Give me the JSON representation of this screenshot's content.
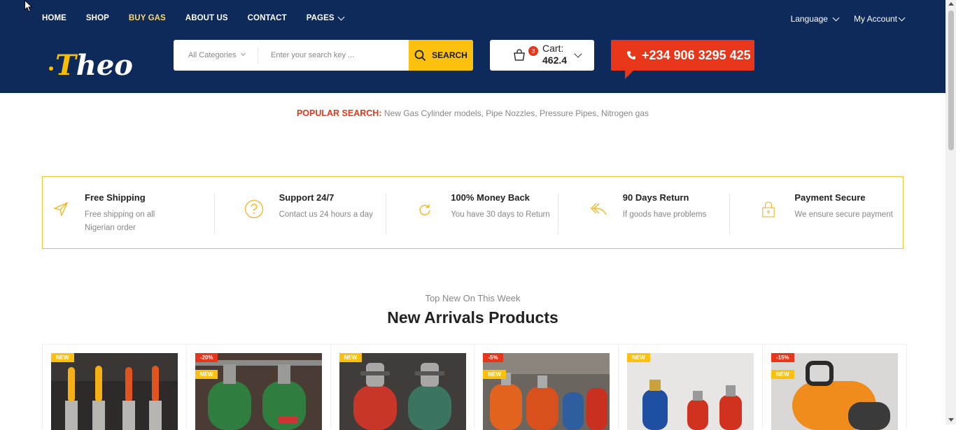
{
  "nav": {
    "items": [
      {
        "label": "HOME",
        "active": false,
        "dropdown": false
      },
      {
        "label": "SHOP",
        "active": false,
        "dropdown": false
      },
      {
        "label": "BUY GAS",
        "active": true,
        "dropdown": false
      },
      {
        "label": "ABOUT US",
        "active": false,
        "dropdown": false
      },
      {
        "label": "CONTACT",
        "active": false,
        "dropdown": false
      },
      {
        "label": "PAGES",
        "active": false,
        "dropdown": true
      }
    ],
    "language": "Language",
    "account": "My Account"
  },
  "logo": {
    "first": "T",
    "rest": "heo"
  },
  "search": {
    "category": "All Categories",
    "placeholder": "Enter your search key ...",
    "button": "SEARCH"
  },
  "cart": {
    "label": "Cart:",
    "amount": "462.4",
    "count": "3"
  },
  "phone": "+234 906 3295 425",
  "popular": {
    "label": "POPULAR SEARCH:",
    "terms": "New Gas Cylinder models, Pipe Nozzles, Pressure Pipes, Nitrogen gas"
  },
  "features": [
    {
      "title": "Free Shipping",
      "desc": "Free shipping on all Nigerian order",
      "icon": "paper-plane-icon"
    },
    {
      "title": "Support 24/7",
      "desc": "Contact us 24 hours a day",
      "icon": "question-circle-icon"
    },
    {
      "title": "100% Money Back",
      "desc": "You have 30 days to Return",
      "icon": "refresh-icon"
    },
    {
      "title": "90 Days Return",
      "desc": "If goods have problems",
      "icon": "reply-arrow-icon"
    },
    {
      "title": "Payment Secure",
      "desc": "We ensure secure payment",
      "icon": "lock-icon"
    }
  ],
  "section": {
    "subtitle": "Top New On This Week",
    "title": "New Arrivals Products"
  },
  "products": [
    {
      "badges": [
        "NEW"
      ],
      "image": "nozzles"
    },
    {
      "badges": [
        "-20%",
        "NEW"
      ],
      "image": "green-cylinders"
    },
    {
      "badges": [
        "NEW"
      ],
      "image": "red-green-cylinders"
    },
    {
      "badges": [
        "-5%",
        "NEW"
      ],
      "image": "orange-cylinders"
    },
    {
      "badges": [
        "NEW"
      ],
      "image": "blue-red-cylinders"
    },
    {
      "badges": [
        "-15%",
        "NEW"
      ],
      "image": "orange-cylinder"
    }
  ],
  "colors": {
    "navy": "#0d2a5b",
    "yellow": "#fcc10f",
    "red": "#e8361a"
  }
}
